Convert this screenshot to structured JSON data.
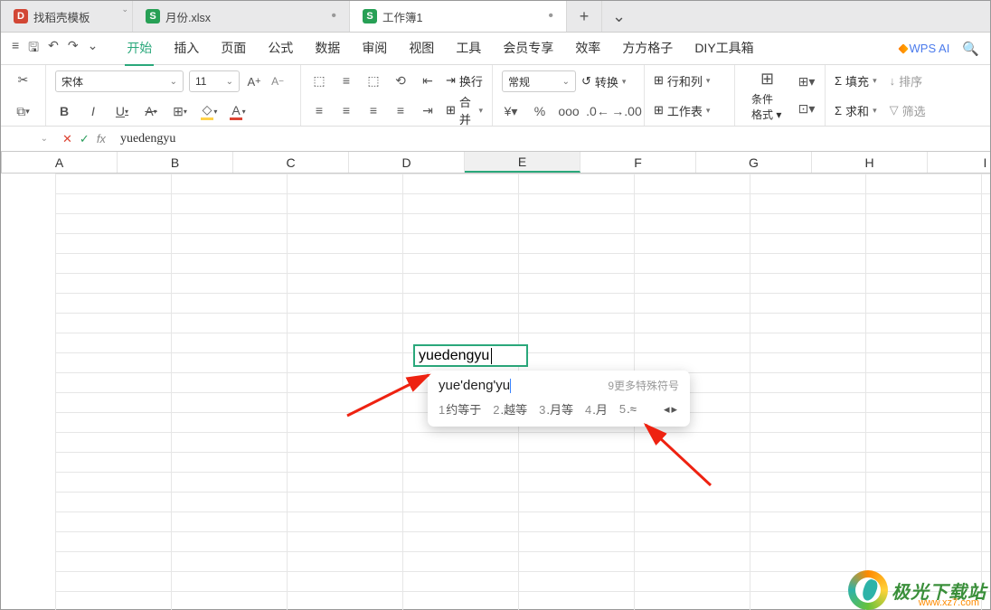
{
  "tabs": [
    {
      "icon": "D",
      "iconColor": "d-red",
      "label": "找稻壳模板",
      "hasDropdown": true
    },
    {
      "icon": "S",
      "iconColor": "d-green",
      "label": "月份.xlsx",
      "modified": true
    },
    {
      "icon": "S",
      "iconColor": "d-green",
      "label": "工作簿1",
      "modified": true,
      "active": true
    }
  ],
  "menu": {
    "items": [
      "开始",
      "插入",
      "页面",
      "公式",
      "数据",
      "审阅",
      "视图",
      "工具",
      "会员专享",
      "效率",
      "方方格子",
      "DIY工具箱"
    ],
    "activeIndex": 0,
    "wpsai": "WPS AI"
  },
  "ribbon": {
    "font": {
      "name": "宋体",
      "size": "11",
      "incLabel": "A⁺",
      "decLabel": "A⁻"
    },
    "fmt": {
      "bold": "B",
      "italic": "I",
      "underline": "U",
      "strike": "A",
      "border": "田",
      "fill": "◇",
      "color": "A"
    },
    "align": {
      "wrap": "换行",
      "merge": "合并"
    },
    "number": {
      "style": "常规",
      "convert": "转换",
      "cur": "¥",
      "pct": "%",
      "comma": "‰",
      "dec1": ".0←",
      ".dec2": "→.00"
    },
    "cells": {
      "rc": "行和列",
      "ws": "工作表"
    },
    "styles": {
      "cf": "条件格式"
    },
    "edit": {
      "fill": "填充",
      "sum": "求和",
      "sort": "排序",
      "filter": "筛选"
    }
  },
  "formulaBar": {
    "name": "",
    "fx": "fx",
    "value": "yuedengyu"
  },
  "columns": [
    "A",
    "B",
    "C",
    "D",
    "E",
    "F",
    "G",
    "H",
    "I"
  ],
  "activeCol": "E",
  "cell": {
    "text": "yuedengyu"
  },
  "ime": {
    "input": "yue'deng'yu",
    "hint": "9更多特殊符号",
    "candidates": [
      {
        "n": "1",
        "t": "约等于",
        "sel": true
      },
      {
        "n": "2",
        "t": "越等"
      },
      {
        "n": "3",
        "t": "月等"
      },
      {
        "n": "4",
        "t": "月"
      },
      {
        "n": "5",
        "t": "≈"
      }
    ]
  },
  "watermark": {
    "title": "极光下载站",
    "url": "www.xz7.com"
  }
}
